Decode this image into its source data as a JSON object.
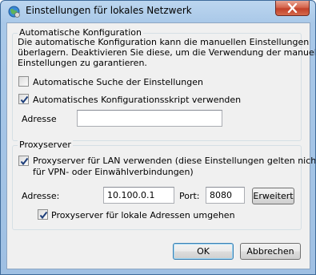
{
  "window": {
    "title": "Einstellungen für lokales Netzwerk",
    "icon": "network-settings-icon",
    "close_icon": "close-icon"
  },
  "auto_config": {
    "legend": "Automatische Konfiguration",
    "description_lines": [
      "Die automatische Konfiguration kann die manuellen Einstellungen",
      "überlagern. Deaktivieren Sie diese, um die Verwendung der manuellen",
      "Einstellungen zu garantieren."
    ],
    "auto_detect": {
      "label": "Automatische Suche der Einstellungen",
      "checked": false
    },
    "use_script": {
      "label": "Automatisches Konfigurationsskript verwenden",
      "checked": true
    },
    "address_label": "Adresse",
    "address_value": ""
  },
  "proxy": {
    "legend": "Proxyserver",
    "use_proxy": {
      "label_lines": [
        "Proxyserver für LAN verwenden (diese Einstellungen gelten nicht",
        "für VPN- oder Einwählverbindungen)"
      ],
      "checked": true
    },
    "address_label": "Adresse:",
    "address_value": "10.100.0.1",
    "port_label": "Port:",
    "port_value": "8080",
    "advanced_button": "Erweitert",
    "bypass_local": {
      "label": "Proxyserver für lokale Adressen umgehen",
      "checked": true
    }
  },
  "buttons": {
    "ok": "OK",
    "cancel": "Abbrechen"
  },
  "colors": {
    "title_gradient": "#bcd6ef",
    "close_red": "#c2412a",
    "dialog_bg": "#f0f0f0",
    "default_button_border": "#3c7fb1"
  }
}
